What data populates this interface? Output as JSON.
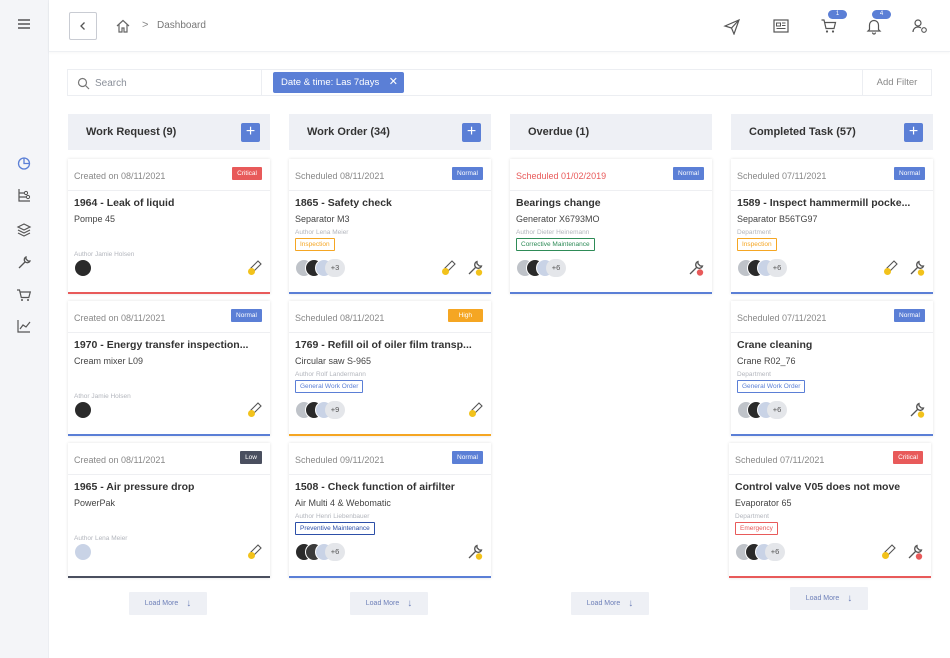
{
  "breadcrumb": {
    "current": "Dashboard",
    "separator": ">"
  },
  "topbar": {
    "cart_badge": "1",
    "bell_badge": "4",
    "icons": [
      "paper-plane-icon",
      "news-icon",
      "cart-icon",
      "bell-icon",
      "user-settings-icon"
    ]
  },
  "sidebar": {
    "icons": [
      "menu-icon",
      "chart-pie-icon",
      "workflow-icon",
      "layers-icon",
      "wrench-icon",
      "cart-icon",
      "analytics-icon"
    ]
  },
  "filter": {
    "search_placeholder": "Search",
    "chip_label": "Date & time: Las 7days",
    "chip_close": "✕",
    "add_filter": "Add Filter"
  },
  "colors": {
    "accent": "#5b7fd6",
    "critical": "#e85a5a",
    "high": "#f5a623",
    "low": "#4a4f5f",
    "normal": "#5b7fd6"
  },
  "columns": [
    {
      "title": "Work Request (9)",
      "add": "+",
      "load_more": "Load More",
      "cards": [
        {
          "date": "Created on 08/11/2021",
          "badge": "Critical",
          "title": "1964 - Leak of liquid",
          "sub": "Pompe 45",
          "author": "Author Jamie Holsen"
        },
        {
          "date": "Created on 08/11/2021",
          "badge": "Normal",
          "title": "1970 - Energy transfer inspection...",
          "sub": "Cream mixer L09",
          "author": "Athor Jamie Holsen"
        },
        {
          "date": "Created on 08/11/2021",
          "badge": "Low",
          "title": "1965 - Air pressure drop",
          "sub": "PowerPak",
          "author": "Author Lena Meier"
        }
      ]
    },
    {
      "title": "Work Order (34)",
      "add": "+",
      "load_more": "Load More",
      "cards": [
        {
          "date": "Scheduled 08/11/2021",
          "badge": "Normal",
          "title": "1865 - Safety check",
          "sub": "Separator M3",
          "meta": "Author Lena Meier",
          "tag": "Inspection",
          "more": "+3"
        },
        {
          "date": "Scheduled 08/11/2021",
          "badge": "High",
          "title": "1769 - Refill oil of oiler film transp...",
          "sub": "Circular saw S-965",
          "meta": "Author Rolf Landermann",
          "tag": "General Work Order",
          "more": "+9"
        },
        {
          "date": "Scheduled 09/11/2021",
          "badge": "Normal",
          "title": "1508 - Check function of airfilter",
          "sub": "Air Multi 4 & Webomatic",
          "meta": "Author Henri Liebenbauer",
          "tag": "Preventive Maintenance",
          "more": "+6"
        }
      ]
    },
    {
      "title": "Overdue (1)",
      "load_more": "Load More",
      "cards": [
        {
          "date": "Scheduled 01/02/2019",
          "badge": "Normal",
          "title": "Bearings change",
          "sub": "Generator X6793MO",
          "meta": "Author Dieter Heinemann",
          "tag": "Corrective Maintenance",
          "more": "+6"
        }
      ]
    },
    {
      "title": "Completed Task  (57)",
      "add": "+",
      "load_more": "Load More",
      "cards": [
        {
          "date": "Scheduled 07/11/2021",
          "badge": "Normal",
          "title": "1589 - Inspect hammermill pocke...",
          "sub": "Separator B56TG97",
          "meta": "Department",
          "tag": "Inspection",
          "more": "+6"
        },
        {
          "date": "Scheduled 07/11/2021",
          "badge": "Normal",
          "title": "Crane cleaning",
          "sub": "Crane R02_76",
          "meta": "Department",
          "tag": "General Work Order",
          "more": "+6"
        },
        {
          "date": "Scheduled 07/11/2021",
          "badge": "Critical",
          "title": "Control valve V05 does not move",
          "sub": "Evaporator 65",
          "meta": "Department",
          "tag": "Emergency",
          "more": "+6"
        }
      ]
    }
  ]
}
